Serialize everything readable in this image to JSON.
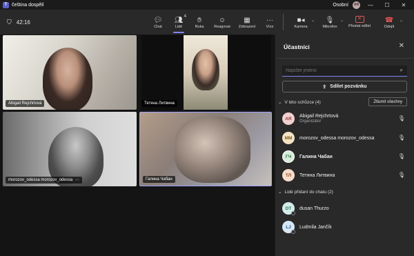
{
  "window": {
    "title": "čeština dospělí",
    "profile_label": "Osobní",
    "profile_initials": "AR",
    "controls": [
      "—",
      "☐",
      "✕"
    ]
  },
  "toolbar": {
    "time": "42:16",
    "items": [
      {
        "label": "Chat",
        "icon": "chat-icon"
      },
      {
        "label": "Lidé",
        "icon": "people-icon",
        "count": "4",
        "active": true
      },
      {
        "label": "Ruka",
        "icon": "raise-hand-icon"
      },
      {
        "label": "Reagovat",
        "icon": "react-icon"
      },
      {
        "label": "Zobrazení",
        "icon": "view-icon"
      },
      {
        "label": "Více",
        "icon": "more-icon"
      }
    ],
    "camera_label": "Kamera",
    "mic_label": "Mikrofon",
    "share_label": "Přestat sdílet",
    "leave_label": "Odejít"
  },
  "stage": {
    "tiles": [
      {
        "name": "Abigail Rejchrtová"
      },
      {
        "name": "Тетяна Литвина"
      },
      {
        "name": "morozov_odessa morozov_odessa",
        "more": "···"
      },
      {
        "name": "Галина Чабан"
      }
    ]
  },
  "panel": {
    "title": "Účastníci",
    "search_placeholder": "Napište jméno",
    "invite_label": "Sdílet pozvánku",
    "in_meeting_label": "V této schůzce (4)",
    "mute_all_label": "Ztlumit všechny",
    "in_meeting": [
      {
        "initials": "AR",
        "name": "Abigail Rejchrtová",
        "role": "Organizátor",
        "bg": "#f2d0d0",
        "fg": "#8a3a3a"
      },
      {
        "initials": "MM",
        "name": "morozov_odessa morozov_odessa",
        "role": "",
        "bg": "#f3e3c2",
        "fg": "#7a5a1c"
      },
      {
        "initials": "ГЧ",
        "name": "Галина Чабан",
        "role": "",
        "bg": "#d7ecd9",
        "fg": "#2f6b39"
      },
      {
        "initials": "ТЛ",
        "name": "Тетяна Литвина",
        "role": "",
        "bg": "#f6dcc9",
        "fg": "#8a4f25"
      }
    ],
    "chat_label": "Lidé přidaní do chatu (2)",
    "chat_people": [
      {
        "initials": "DT",
        "name": "dusan Thurzo",
        "bg": "#d3eee9",
        "fg": "#2c6e63"
      },
      {
        "initials": "LJ",
        "name": "Ludmila Jančík",
        "bg": "#d6e7f6",
        "fg": "#2f5a85"
      }
    ]
  }
}
